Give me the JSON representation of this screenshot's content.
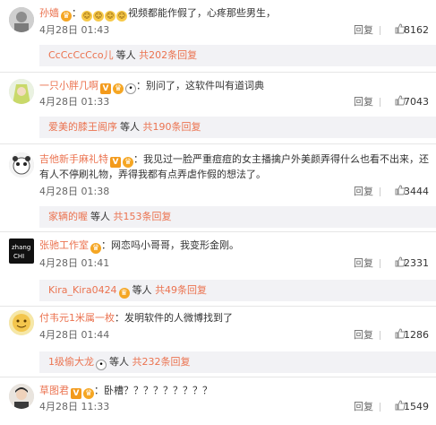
{
  "reply_label": "回复",
  "others_label": "等人",
  "comments": [
    {
      "username": "孙嫱",
      "badges": [
        "crown"
      ],
      "emojis": [
        "😂",
        "😂",
        "😂",
        "😂"
      ],
      "text": "视频都能作假了，心疼那些男生，",
      "time": "4月28日 01:43",
      "likes": "8162",
      "sub_user": "CcCcCcCco儿",
      "sub_more": "共202条回复"
    },
    {
      "username": "一只小胖几啊",
      "badges": [
        "v",
        "crown",
        "panda"
      ],
      "emojis": [],
      "text": "：别问了，这软件叫有道词典",
      "time": "4月28日 01:33",
      "likes": "7043",
      "sub_user": "爱美的膝王阁序",
      "sub_more": "共190条回复"
    },
    {
      "username": "吉他新手麻礼特",
      "badges": [
        "v",
        "crown"
      ],
      "emojis": [],
      "text": "：我见过一脸严重痘痘的女主播擒户外美颜弄得什么也看不出来，还有人不停刷礼物，弄得我都有点弄虐作假的想法了。",
      "time": "4月28日 01:38",
      "likes": "3444",
      "sub_user": "家辆的喔",
      "sub_more": "共153条回复"
    },
    {
      "username": "张驰工作室",
      "badges": [
        "crown"
      ],
      "emojis": [],
      "text": "：网恋吗小哥哥，我变形金刚。",
      "time": "4月28日 01:41",
      "likes": "2331",
      "sub_user": "Kira_Kira0424",
      "sub_more": "共49条回复"
    },
    {
      "username": "付韦元1米属一枚",
      "badges": [],
      "emojis": [],
      "text": "：发明软件的人微博找到了",
      "time": "4月28日 01:44",
      "likes": "1286",
      "sub_user": "1级偷大龙",
      "sub_more": "共232条回复"
    },
    {
      "username": "草图君",
      "badges": [
        "v",
        "crown"
      ],
      "emojis": [],
      "text": "：卧槽？？？？？？？？？",
      "time": "4月28日 11:33",
      "likes": "1549",
      "sub_user": "",
      "sub_more": ""
    }
  ],
  "colors": {
    "username": "#eb7350",
    "subbox_bg": "#f2f2f5",
    "badge_v": "#f39a1b"
  },
  "icons": {
    "like": "thumbs-up-icon",
    "v": "verified-v-icon",
    "crown": "vip-crown-icon",
    "panda": "panda-icon"
  }
}
